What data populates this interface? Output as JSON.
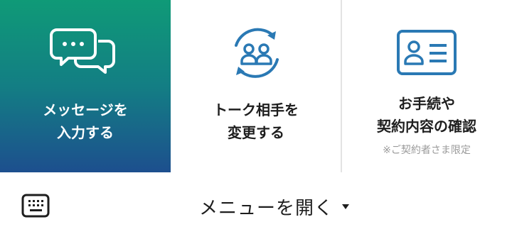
{
  "menu": {
    "tiles": [
      {
        "id": "message",
        "icon": "speech-bubbles-icon",
        "lines": [
          "メッセージを",
          "入力する"
        ]
      },
      {
        "id": "change-partner",
        "icon": "swap-people-icon",
        "lines": [
          "トーク相手を",
          "変更する"
        ]
      },
      {
        "id": "contract",
        "icon": "id-card-icon",
        "lines": [
          "お手続や",
          "契約内容の確認"
        ],
        "note": "※ご契約者さま限定"
      }
    ]
  },
  "bottom_bar": {
    "keyboard_icon": "keyboard-icon",
    "open_menu_label": "メニューを開く",
    "caret_icon": "caret-down-icon"
  },
  "colors": {
    "gradient_top": "#0f9a77",
    "gradient_bottom": "#1d4f8e",
    "icon_blue": "#2a79b4",
    "text": "#1e1e1e",
    "note": "#9a9a9a"
  }
}
